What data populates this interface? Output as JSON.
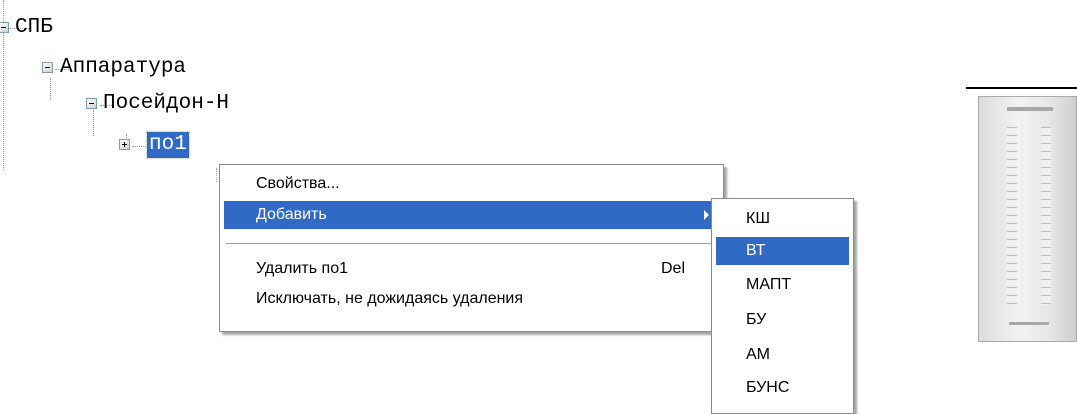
{
  "tree": {
    "root": "СПБ",
    "child": "Аппаратура",
    "grandchild": "Посейдон-Н",
    "selected": "по1"
  },
  "context_menu": {
    "properties": "Свойства...",
    "add": "Добавить",
    "delete": "Удалить по1",
    "delete_shortcut": "Del",
    "exclude": "Исключать, не дожидаясь удаления"
  },
  "submenu": {
    "items": [
      "КШ",
      "ВТ",
      "МАПТ",
      "БУ",
      "АМ",
      "БУНС"
    ],
    "highlighted": "ВТ"
  },
  "colors": {
    "selection": "#316ac5",
    "menu_border": "#8a8a8a"
  }
}
